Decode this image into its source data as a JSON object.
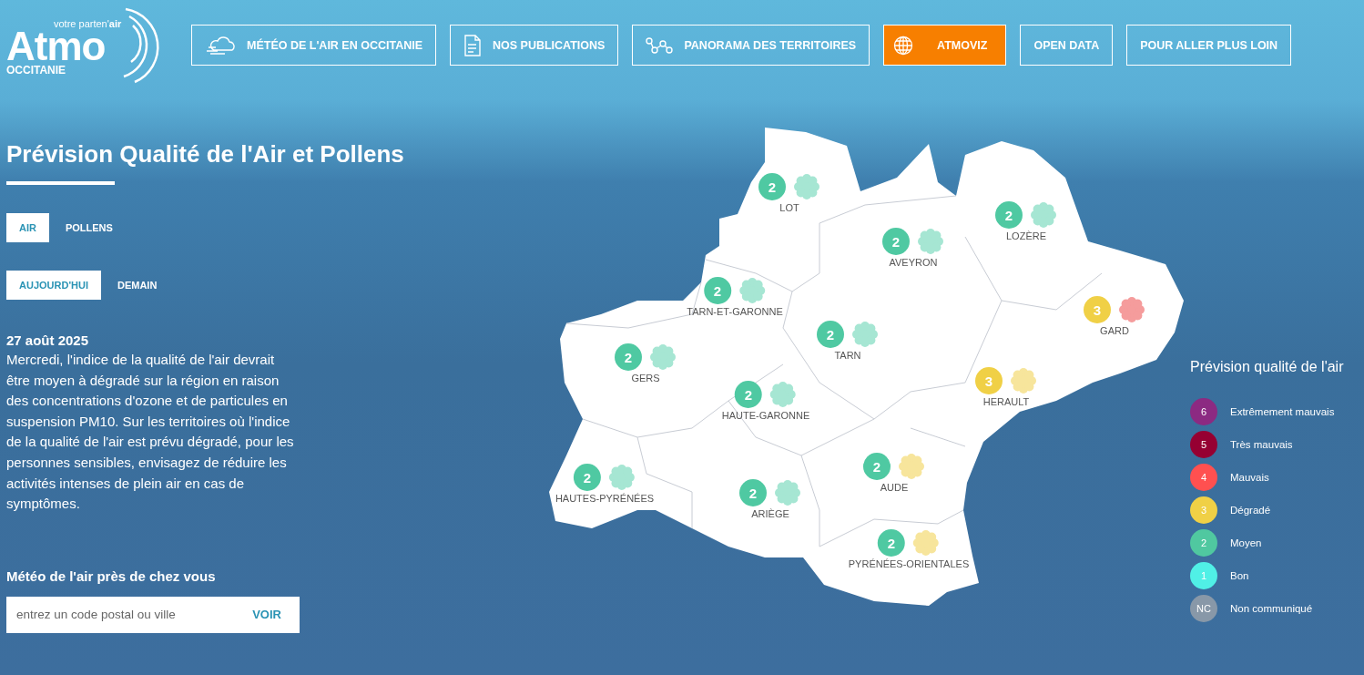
{
  "logo": {
    "name": "Atmo",
    "tagline": "votre parten'**air**",
    "region": "OCCITANIE"
  },
  "nav": [
    {
      "label": "MÉTÉO DE L'AIR EN OCCITANIE",
      "selected": false
    },
    {
      "label": "NOS PUBLICATIONS",
      "selected": false
    },
    {
      "label": "PANORAMA DES TERRITOIRES",
      "selected": false
    },
    {
      "label": "ATMOVIZ",
      "selected": true
    },
    {
      "label": "OPEN DATA",
      "selected": false
    },
    {
      "label": "POUR ALLER PLUS LOIN",
      "selected": false
    }
  ],
  "title": "Prévision Qualité de l'Air et Pollens",
  "type_tabs": [
    {
      "label": "AIR",
      "selected": true
    },
    {
      "label": "POLLENS",
      "selected": false
    }
  ],
  "day_tabs": [
    {
      "label": "AUJOURD'HUI",
      "selected": true
    },
    {
      "label": "DEMAIN",
      "selected": false
    }
  ],
  "bulletin": {
    "date": "27 août 2025",
    "text": "Mercredi, l'indice de la qualité de l'air devrait être moyen à dégradé sur la région en raison des concentrations d'ozone et de particules en suspension PM10. Sur les territoires où l'indice de la qualité de l'air est prévu dégradé, pour les personnes sensibles, envisagez de réduire les activités intenses de plein air en cas de symptômes."
  },
  "search": {
    "title": "Météo de l'air près de chez vous",
    "placeholder": "entrez un code postal ou ville",
    "button": "VOIR"
  },
  "departments": [
    {
      "name": "LOT",
      "index": "2",
      "color": "#4fc9a2",
      "pollen": {
        "color": "#a6e6d3"
      }
    },
    {
      "name": "AVEYRON",
      "index": "2",
      "color": "#4fc9a2",
      "pollen": {
        "color": "#a6e6d3"
      }
    },
    {
      "name": "LOZÈRE",
      "index": "2",
      "color": "#4fc9a2",
      "pollen": {
        "color": "#a6e6d3"
      }
    },
    {
      "name": "TARN-ET-GARONNE",
      "index": "2",
      "color": "#4fc9a2",
      "pollen": {
        "color": "#a6e6d3"
      }
    },
    {
      "name": "GARD",
      "index": "3",
      "color": "#f0d046",
      "pollen": {
        "color": "#f59c9c"
      }
    },
    {
      "name": "TARN",
      "index": "2",
      "color": "#4fc9a2",
      "pollen": {
        "color": "#a6e6d3"
      }
    },
    {
      "name": "GERS",
      "index": "2",
      "color": "#4fc9a2",
      "pollen": {
        "color": "#a6e6d3"
      }
    },
    {
      "name": "HERAULT",
      "index": "3",
      "color": "#f0d046",
      "pollen": {
        "color": "#f7e59c"
      }
    },
    {
      "name": "HAUTE-GARONNE",
      "index": "2",
      "color": "#4fc9a2",
      "pollen": {
        "color": "#a6e6d3"
      }
    },
    {
      "name": "HAUTES-PYRÉNÉES",
      "index": "2",
      "color": "#4fc9a2",
      "pollen": {
        "color": "#a6e6d3"
      }
    },
    {
      "name": "ARIÈGE",
      "index": "2",
      "color": "#4fc9a2",
      "pollen": {
        "color": "#a6e6d3"
      }
    },
    {
      "name": "AUDE",
      "index": "2",
      "color": "#4fc9a2",
      "pollen": {
        "color": "#f7e59c"
      }
    },
    {
      "name": "PYRÉNÉES-ORIENTALES",
      "index": "2",
      "color": "#4fc9a2",
      "pollen": {
        "color": "#f7e59c"
      }
    }
  ],
  "legend": {
    "title": "Prévision qualité de l'air",
    "items": [
      {
        "value": "6",
        "label": "Extrêmement mauvais",
        "color": "#8c2a82"
      },
      {
        "value": "5",
        "label": "Très mauvais",
        "color": "#960032"
      },
      {
        "value": "4",
        "label": "Mauvais",
        "color": "#ff5050"
      },
      {
        "value": "3",
        "label": "Dégradé",
        "color": "#f0d046"
      },
      {
        "value": "2",
        "label": "Moyen",
        "color": "#50c8a0"
      },
      {
        "value": "1",
        "label": "Bon",
        "color": "#50f0e6"
      },
      {
        "value": "NC",
        "label": "Non communiqué",
        "color": "#8898a8"
      }
    ]
  }
}
